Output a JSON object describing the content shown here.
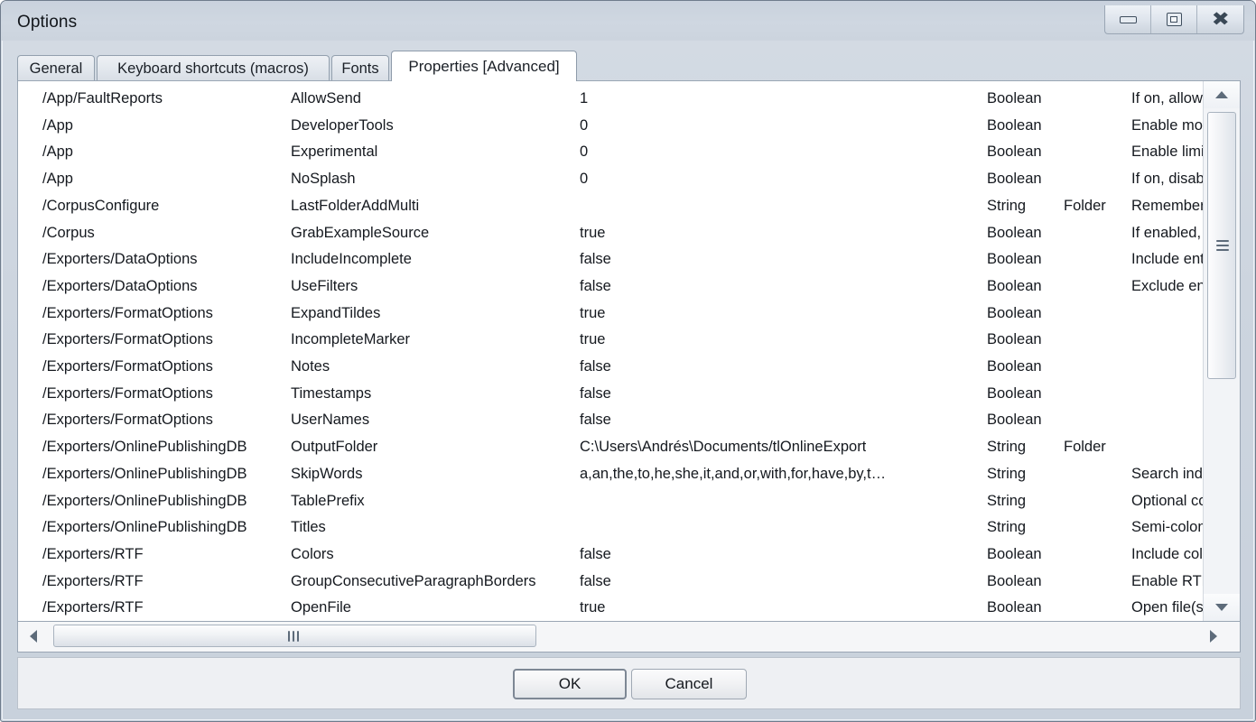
{
  "window": {
    "title": "Options",
    "controls": {
      "minimize": "minimize",
      "restore": "restore",
      "close": "close"
    }
  },
  "tabs": [
    {
      "label": "General",
      "active": false
    },
    {
      "label": "Keyboard shortcuts (macros)",
      "active": false
    },
    {
      "label": "Fonts",
      "active": false
    },
    {
      "label": "Properties [Advanced]",
      "active": true
    }
  ],
  "list": {
    "rows": [
      {
        "path": "/App/FaultReports",
        "key": "AllowSend",
        "value": "1",
        "type": "Boolean",
        "extra": "",
        "desc": "If on, allows"
      },
      {
        "path": "/App",
        "key": "DeveloperTools",
        "value": "0",
        "type": "Boolean",
        "extra": "",
        "desc": "Enable most"
      },
      {
        "path": "/App",
        "key": "Experimental",
        "value": "0",
        "type": "Boolean",
        "extra": "",
        "desc": "Enable limite"
      },
      {
        "path": "/App",
        "key": "NoSplash",
        "value": "0",
        "type": "Boolean",
        "extra": "",
        "desc": "If on, disabl"
      },
      {
        "path": "/CorpusConfigure",
        "key": "LastFolderAddMulti",
        "value": "",
        "type": "String",
        "extra": "Folder",
        "desc": "Remember l"
      },
      {
        "path": "/Corpus",
        "key": "GrabExampleSource",
        "value": "true",
        "type": "Boolean",
        "extra": "",
        "desc": "If enabled,"
      },
      {
        "path": "/Exporters/DataOptions",
        "key": "IncludeIncomplete",
        "value": "false",
        "type": "Boolean",
        "extra": "",
        "desc": "Include entr"
      },
      {
        "path": "/Exporters/DataOptions",
        "key": "UseFilters",
        "value": "false",
        "type": "Boolean",
        "extra": "",
        "desc": "Exclude entr"
      },
      {
        "path": "/Exporters/FormatOptions",
        "key": "ExpandTildes",
        "value": "true",
        "type": "Boolean",
        "extra": "",
        "desc": ""
      },
      {
        "path": "/Exporters/FormatOptions",
        "key": "IncompleteMarker",
        "value": "true",
        "type": "Boolean",
        "extra": "",
        "desc": ""
      },
      {
        "path": "/Exporters/FormatOptions",
        "key": "Notes",
        "value": "false",
        "type": "Boolean",
        "extra": "",
        "desc": ""
      },
      {
        "path": "/Exporters/FormatOptions",
        "key": "Timestamps",
        "value": "false",
        "type": "Boolean",
        "extra": "",
        "desc": ""
      },
      {
        "path": "/Exporters/FormatOptions",
        "key": "UserNames",
        "value": "false",
        "type": "Boolean",
        "extra": "",
        "desc": ""
      },
      {
        "path": "/Exporters/OnlinePublishingDB",
        "key": "OutputFolder",
        "value": "C:\\Users\\Andrés\\Documents/tlOnlineExport",
        "type": "String",
        "extra": "Folder",
        "desc": ""
      },
      {
        "path": "/Exporters/OnlinePublishingDB",
        "key": "SkipWords",
        "value": "a,an,the,to,he,she,it,and,or,with,for,have,by,t…",
        "type": "String",
        "extra": "",
        "desc": "Search inde"
      },
      {
        "path": "/Exporters/OnlinePublishingDB",
        "key": "TablePrefix",
        "value": "",
        "type": "String",
        "extra": "",
        "desc": "Optional cor"
      },
      {
        "path": "/Exporters/OnlinePublishingDB",
        "key": "Titles",
        "value": "",
        "type": "String",
        "extra": "",
        "desc": "Semi-colon-s"
      },
      {
        "path": "/Exporters/RTF",
        "key": "Colors",
        "value": "false",
        "type": "Boolean",
        "extra": "",
        "desc": "Include colo"
      },
      {
        "path": "/Exporters/RTF",
        "key": "GroupConsecutiveParagraphBorders",
        "value": "false",
        "type": "Boolean",
        "extra": "",
        "desc": "Enable RTF"
      },
      {
        "path": "/Exporters/RTF",
        "key": "OpenFile",
        "value": "true",
        "type": "Boolean",
        "extra": "",
        "desc": "Open file(s)"
      }
    ]
  },
  "scrollbars": {
    "vertical": {
      "up_arrow": "scroll-up",
      "down_arrow": "scroll-down",
      "thumb": "vertical-thumb"
    },
    "horizontal": {
      "left_arrow": "scroll-left",
      "right_arrow": "scroll-right",
      "thumb": "horizontal-thumb"
    }
  },
  "buttons": {
    "ok": "OK",
    "cancel": "Cancel"
  }
}
